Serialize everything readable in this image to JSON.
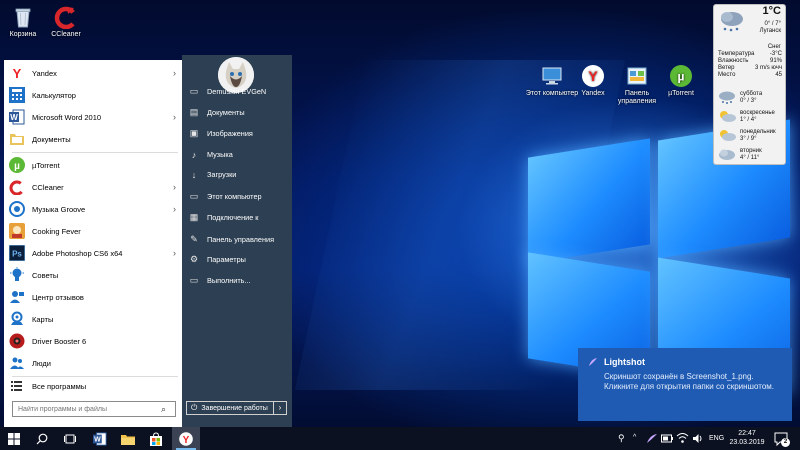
{
  "desktop": {
    "top_icons": [
      {
        "label": "Корзина",
        "icon": "recycle-bin-icon"
      },
      {
        "label": "CCleaner",
        "icon": "ccleaner-icon"
      }
    ],
    "right_icons": [
      {
        "label": "Этот компьютер",
        "icon": "computer-icon"
      },
      {
        "label": "Yandex",
        "icon": "yandex-icon"
      },
      {
        "label": "Панель управления",
        "icon": "control-panel-icon"
      },
      {
        "label": "µTorrent",
        "icon": "utorrent-icon"
      }
    ]
  },
  "start_menu": {
    "apps": [
      {
        "label": "Yandex",
        "icon": "yandex-icon",
        "submenu": true
      },
      {
        "label": "Калькулятор",
        "icon": "calculator-icon",
        "submenu": false
      },
      {
        "label": "Microsoft Word 2010",
        "icon": "word-icon",
        "submenu": true
      },
      {
        "label": "Документы",
        "icon": "documents-icon",
        "submenu": false
      },
      {
        "label": "µTorrent",
        "icon": "utorrent-icon",
        "submenu": false
      },
      {
        "label": "CCleaner",
        "icon": "ccleaner-icon",
        "submenu": true
      },
      {
        "label": "Музыка Groove",
        "icon": "groove-music-icon",
        "submenu": true
      },
      {
        "label": "Cooking Fever",
        "icon": "cooking-fever-icon",
        "submenu": false
      },
      {
        "label": "Adobe Photoshop CS6 x64",
        "icon": "photoshop-icon",
        "submenu": true
      },
      {
        "label": "Советы",
        "icon": "tips-icon",
        "submenu": false
      },
      {
        "label": "Центр отзывов",
        "icon": "feedback-hub-icon",
        "submenu": false
      },
      {
        "label": "Карты",
        "icon": "maps-icon",
        "submenu": false
      },
      {
        "label": "Driver Booster 6",
        "icon": "driver-booster-icon",
        "submenu": false
      },
      {
        "label": "Люди",
        "icon": "people-icon",
        "submenu": false
      }
    ],
    "all_programs": "Все программы",
    "search_placeholder": "Найти программы и файлы",
    "user_name": "Demuskin EVGeN",
    "places": [
      {
        "label": "Документы",
        "icon": "documents-icon"
      },
      {
        "label": "Изображения",
        "icon": "pictures-icon"
      },
      {
        "label": "Музыка",
        "icon": "music-icon"
      },
      {
        "label": "Загрузки",
        "icon": "downloads-icon"
      },
      {
        "label": "Этот компьютер",
        "icon": "computer-icon"
      },
      {
        "label": "Подключение к",
        "icon": "connect-icon"
      },
      {
        "label": "Панель управления",
        "icon": "control-panel-icon"
      },
      {
        "label": "Параметры",
        "icon": "settings-icon"
      },
      {
        "label": "Выполнить...",
        "icon": "run-icon"
      }
    ],
    "shutdown_label": "Завершение работы"
  },
  "weather": {
    "temperature": "1°C",
    "range": "0° / 7°",
    "city": "Луганск",
    "condition": "Снег",
    "details": [
      {
        "label": "Температура",
        "value": "-3°C"
      },
      {
        "label": "Влажность",
        "value": "91%"
      },
      {
        "label": "Ветер",
        "value": "3 m/s ючч"
      },
      {
        "label": "Место",
        "value": "45"
      }
    ],
    "forecast": [
      {
        "day": "суббота",
        "temps": "0° / 3°"
      },
      {
        "day": "воскресенье",
        "temps": "1° / 4°"
      },
      {
        "day": "понедельник",
        "temps": "3° / 9°"
      },
      {
        "day": "вторник",
        "temps": "4° / 11°"
      }
    ]
  },
  "notification": {
    "app": "Lightshot",
    "message": "Скриншот сохранён в Screenshot_1.png. Кликните для открытия папки со скриншотом."
  },
  "taskbar": {
    "language": "ENG",
    "time": "22:47",
    "date": "23.03.2019",
    "notification_count": "2"
  }
}
